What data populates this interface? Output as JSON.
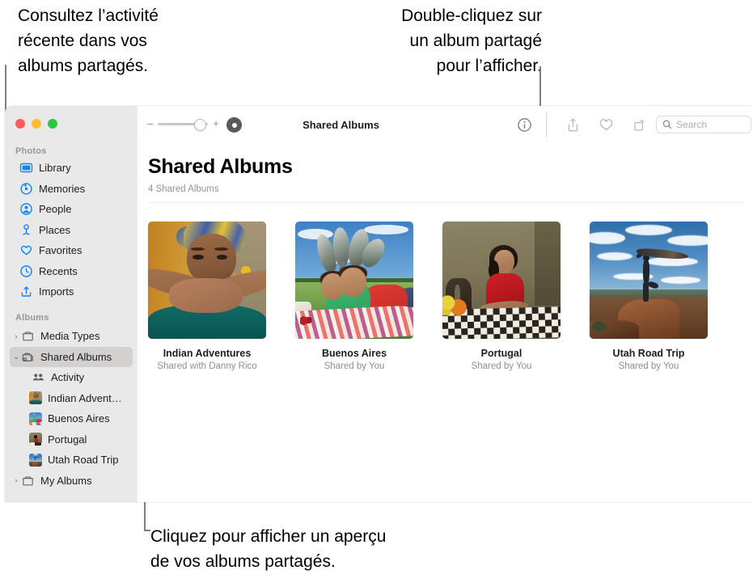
{
  "callouts": {
    "activity": "Consultez l’activité\nrécente dans vos\nalbums partagés.",
    "double_click": "Double-cliquez sur\nun album partagé\npour l’afficher.",
    "preview": "Cliquez pour afficher un aperçu\nde vos albums partagés."
  },
  "window": {
    "traffic_lights": [
      "close",
      "minimize",
      "maximize"
    ],
    "toolbar": {
      "zoom_minus": "–",
      "zoom_plus": "+",
      "view_mode_icon": "view-mode-icon",
      "title": "Shared Albums",
      "info_icon": "info-icon",
      "share_icon": "share-icon",
      "favorite_icon": "heart-icon",
      "rotate_icon": "rotate-icon",
      "search_icon": "search-icon",
      "search_placeholder": "Search",
      "search_value": ""
    },
    "sidebar": {
      "groups": [
        {
          "title": "Photos",
          "items": [
            {
              "label": "Library",
              "icon": "library-icon"
            },
            {
              "label": "Memories",
              "icon": "memories-icon"
            },
            {
              "label": "People",
              "icon": "people-icon"
            },
            {
              "label": "Places",
              "icon": "places-icon"
            },
            {
              "label": "Favorites",
              "icon": "heart-icon"
            },
            {
              "label": "Recents",
              "icon": "clock-icon"
            },
            {
              "label": "Imports",
              "icon": "import-icon"
            }
          ]
        },
        {
          "title": "Albums",
          "items": [
            {
              "label": "Media Types",
              "icon": "folder-icon",
              "chevron": "›",
              "selected": false
            },
            {
              "label": "Shared Albums",
              "icon": "shared-folder-icon",
              "chevron": "⌄",
              "selected": true
            },
            {
              "label": "Activity",
              "icon": "people-group-icon",
              "child": true
            },
            {
              "label": "Indian Advent…",
              "icon": "album-thumb-1",
              "child": true
            },
            {
              "label": "Buenos Aires",
              "icon": "album-thumb-2",
              "child": true
            },
            {
              "label": "Portugal",
              "icon": "album-thumb-3",
              "child": true
            },
            {
              "label": "Utah Road Trip",
              "icon": "album-thumb-4",
              "child": true
            },
            {
              "label": "My Albums",
              "icon": "folder-icon",
              "chevron": "›",
              "selected": false
            }
          ]
        }
      ]
    },
    "content": {
      "title": "Shared Albums",
      "subtitle": "4 Shared Albums",
      "albums": [
        {
          "name": "Indian Adventures",
          "shared": "Shared with Danny Rico",
          "photo": "woman-with-headwrap"
        },
        {
          "name": "Buenos Aires",
          "shared": "Shared by You",
          "photo": "two-kids-on-picnic-blanket"
        },
        {
          "name": "Portugal",
          "shared": "Shared by You",
          "photo": "woman-at-checkered-table"
        },
        {
          "name": "Utah Road Trip",
          "shared": "Shared by You",
          "photo": "silhouette-on-red-rock"
        }
      ]
    }
  },
  "colors": {
    "sidebar_bg": "#e9e9e9",
    "sidebar_icon_blue": "#0a84ff",
    "selected_row": "#d2d1d0",
    "leader_line": "#808080",
    "subtitle_gray": "#8e8e93"
  }
}
